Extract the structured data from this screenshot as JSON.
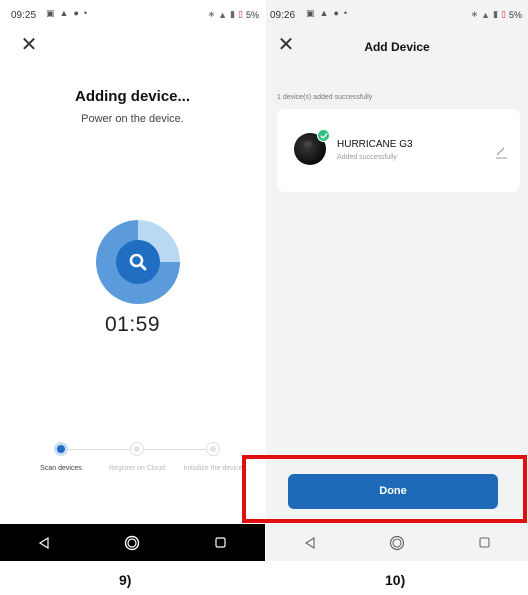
{
  "left_screen": {
    "status": {
      "time": "09:25",
      "battery": "5%"
    },
    "title": "Adding device...",
    "subtitle": "Power on the device.",
    "timer": "01:59",
    "steps": [
      {
        "label": "Scan devices",
        "active": true
      },
      {
        "label": "Register on Cloud",
        "active": false
      },
      {
        "label": "Initialize the device",
        "active": false
      }
    ]
  },
  "right_screen": {
    "status": {
      "time": "09:26",
      "battery": "5%"
    },
    "title": "Add Device",
    "added_count": "1 device(s) added successfully",
    "device": {
      "name": "HURRICANE G3",
      "status": "Added successfully"
    },
    "done_label": "Done"
  },
  "captions": {
    "left": "9)",
    "right": "10)"
  },
  "icons": {
    "close": "close-icon",
    "scan": "search-icon",
    "edit": "pencil-icon",
    "check": "check-icon",
    "nav_back": "back-triangle-icon",
    "nav_home": "home-circle-icon",
    "nav_recent": "recents-square-icon"
  },
  "colors": {
    "primary": "#1e6ab8",
    "success": "#2ec27e",
    "highlight": "#e01010",
    "right_bg": "#f2f3f5"
  }
}
